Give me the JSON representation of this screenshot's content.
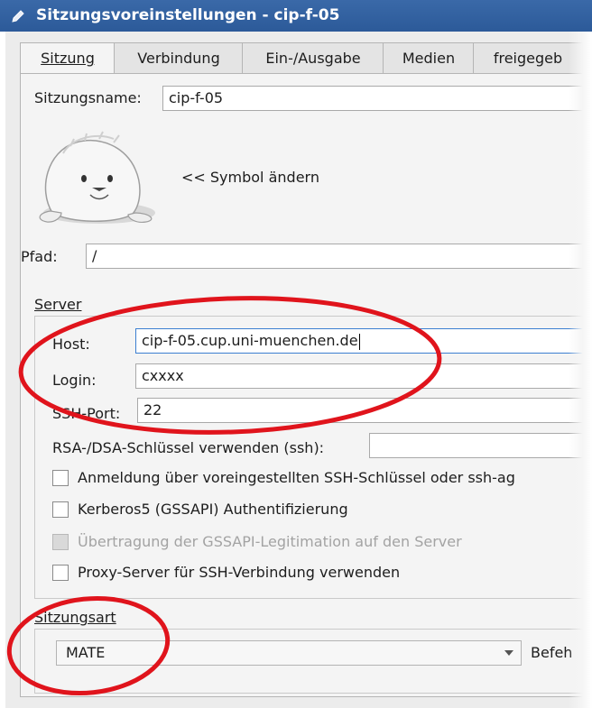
{
  "window": {
    "title": "Sitzungsvoreinstellungen - cip-f-05"
  },
  "tabs": [
    "Sitzung",
    "Verbindung",
    "Ein-/Ausgabe",
    "Medien",
    "freigegeb"
  ],
  "session": {
    "name_label": "Sitzungsname:",
    "name_value": "cip-f-05",
    "icon_label": "<< Symbol ändern",
    "path_label": "Pfad:",
    "path_value": "/"
  },
  "server": {
    "group_label": "Server",
    "host_label": "Host:",
    "host_value": "cip-f-05.cup.uni-muenchen.de",
    "login_label": "Login:",
    "login_value": "cxxxx",
    "port_label": "SSH-Port:",
    "port_value": "22",
    "rsa_label": "RSA-/DSA-Schlüssel verwenden (ssh):",
    "options": [
      {
        "label": "Anmeldung über voreingestellten SSH-Schlüssel oder ssh-ag",
        "checked": false,
        "disabled": false
      },
      {
        "label": "Kerberos5 (GSSAPI) Authentifizierung",
        "checked": false,
        "disabled": false
      },
      {
        "label": "Übertragung der GSSAPI-Legitimation auf den Server",
        "checked": false,
        "disabled": true
      },
      {
        "label": "Proxy-Server für SSH-Verbindung verwenden",
        "checked": false,
        "disabled": false
      }
    ]
  },
  "session_type": {
    "group_label": "Sitzungsart",
    "selected": "MATE",
    "command_label": "Befeh"
  },
  "colors": {
    "titlebar": "#2f5e9e",
    "annotation": "#e0141c",
    "focus_border": "#3c7fd1"
  }
}
